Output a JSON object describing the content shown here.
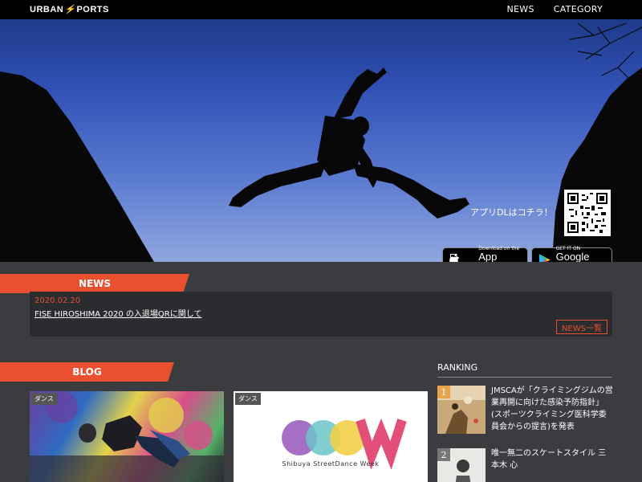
{
  "header": {
    "logo_left": "URBAN",
    "logo_right": "PORTS",
    "nav": [
      "NEWS",
      "CATEGORY"
    ]
  },
  "hero": {
    "app_dl_text": "アプリDLはコチラ！",
    "app_store": {
      "small": "Download on the",
      "big": "App Store"
    },
    "google_play": {
      "small": "GET IT ON",
      "big": "Google Play"
    }
  },
  "news": {
    "heading": "NEWS",
    "items": [
      {
        "date": "2020.02.20",
        "title": "FISE HIROSHIMA 2020 の入退場QRに関して"
      }
    ],
    "more_label": "NEWS一覧"
  },
  "blog": {
    "heading": "BLOG",
    "cards": [
      {
        "tag": "ダンス"
      },
      {
        "tag": "ダンス",
        "brand_caption": "Shibuya StreetDance Week"
      }
    ]
  },
  "ranking": {
    "heading": "RANKING",
    "items": [
      {
        "rank": "1",
        "title": "JMSCAが「クライミングジムの営業再開に向けた感染予防指針」(スポーツクライミング医科学委員会からの提言)を発表"
      },
      {
        "rank": "2",
        "title": "唯一無二のスケートスタイル 三本木 心"
      }
    ]
  },
  "colors": {
    "accent": "#e8502f",
    "header_bg": "#000000",
    "page_bg": "#3a3c40",
    "panel_bg": "#2b2c2f"
  }
}
